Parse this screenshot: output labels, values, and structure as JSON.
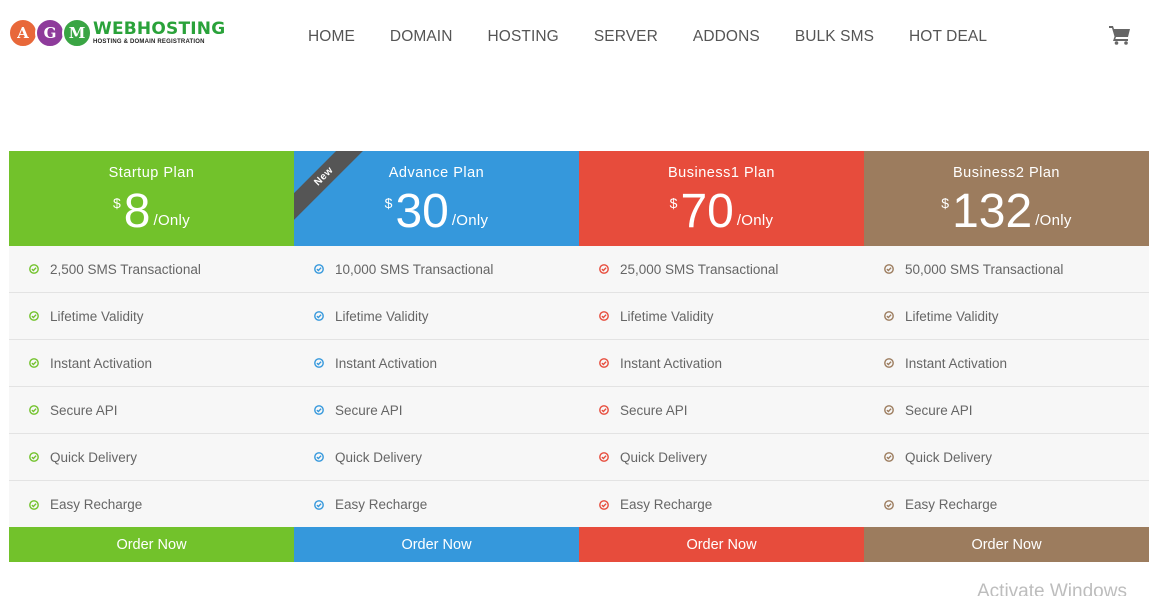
{
  "logo": {
    "letters": [
      "A",
      "G",
      "M"
    ],
    "letter_colors": [
      "#e8683a",
      "#8e3b9b",
      "#3aa544"
    ],
    "title": "WEBHOSTING",
    "title_color": "#2aa23a",
    "subtitle": "HOSTING & DOMAIN REGISTRATION"
  },
  "nav": [
    "HOME",
    "DOMAIN",
    "HOSTING",
    "SERVER",
    "ADDONS",
    "BULK SMS",
    "HOT DEAL"
  ],
  "cart_icon": "cart-icon",
  "plans": [
    {
      "name": "Startup Plan",
      "currency": "$",
      "amount": "8",
      "per": "/Only",
      "color": "#72c22b",
      "check_color": "#72c22b",
      "ribbon": "",
      "features": [
        "2,500 SMS Transactional",
        "Lifetime Validity",
        "Instant Activation",
        "Secure API",
        "Quick Delivery",
        "Easy Recharge"
      ],
      "button": "Order Now"
    },
    {
      "name": "Advance Plan",
      "currency": "$",
      "amount": "30",
      "per": "/Only",
      "color": "#3598dc",
      "check_color": "#3598dc",
      "ribbon": "New",
      "features": [
        "10,000 SMS Transactional",
        "Lifetime Validity",
        "Instant Activation",
        "Secure API",
        "Quick Delivery",
        "Easy Recharge"
      ],
      "button": "Order Now"
    },
    {
      "name": "Business1 Plan",
      "currency": "$",
      "amount": "70",
      "per": "/Only",
      "color": "#e74c3c",
      "check_color": "#e74c3c",
      "ribbon": "",
      "features": [
        "25,000 SMS Transactional",
        "Lifetime Validity",
        "Instant Activation",
        "Secure API",
        "Quick Delivery",
        "Easy Recharge"
      ],
      "button": "Order Now"
    },
    {
      "name": "Business2 Plan",
      "currency": "$",
      "amount": "132",
      "per": "/Only",
      "color": "#9c7c5e",
      "check_color": "#9c7c5e",
      "ribbon": "",
      "features": [
        "50,000 SMS Transactional",
        "Lifetime Validity",
        "Instant Activation",
        "Secure API",
        "Quick Delivery",
        "Easy Recharge"
      ],
      "button": "Order Now"
    }
  ],
  "watermark": "Activate Windows"
}
